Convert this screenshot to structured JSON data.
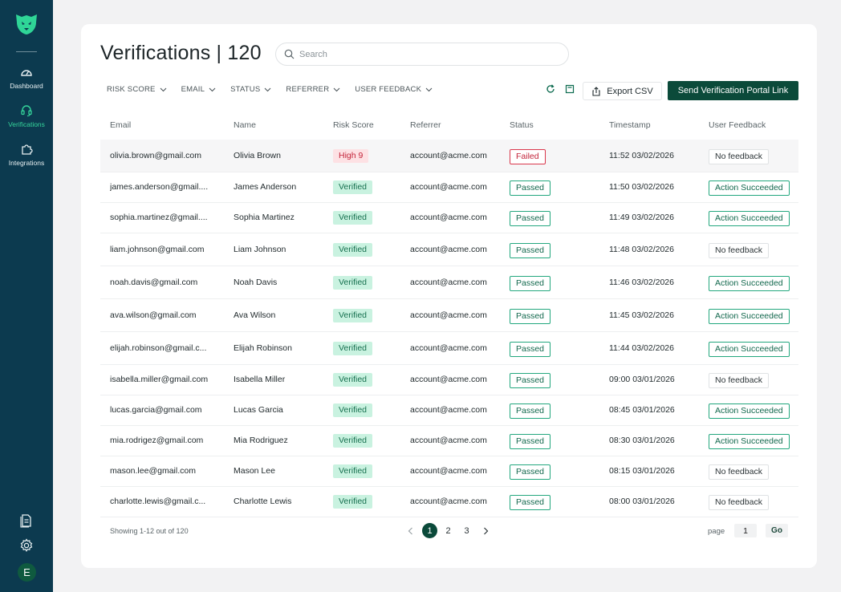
{
  "sidebar": {
    "items": [
      {
        "label": "Dashboard",
        "icon": "dashboard-icon"
      },
      {
        "label": "Verifications",
        "icon": "headset-icon",
        "active": true
      },
      {
        "label": "Integrations",
        "icon": "puzzle-icon"
      }
    ],
    "avatar_initial": "E"
  },
  "header": {
    "title": "Verifications | 120",
    "search_placeholder": "Search"
  },
  "filters": [
    "RISK SCORE",
    "EMAIL",
    "STATUS",
    "REFERRER",
    "USER FEEDBACK"
  ],
  "toolbar": {
    "export_label": "Export CSV",
    "send_label": "Send Verification Portal Link"
  },
  "table": {
    "columns": [
      "Email",
      "Name",
      "Risk Score",
      "Referrer",
      "Status",
      "Timestamp",
      "User Feedback"
    ],
    "rows": [
      {
        "email": "olivia.brown@gmail.com",
        "name": "Olivia Brown",
        "risk": "High 9",
        "referrer": "account@acme.com",
        "status": "Failed",
        "timestamp": "11:52 03/02/2026",
        "feedback": "No feedback"
      },
      {
        "email": "james.anderson@gmail....",
        "name": "James Anderson",
        "risk": "Verified",
        "referrer": "account@acme.com",
        "status": "Passed",
        "timestamp": "11:50 03/02/2026",
        "feedback": "Action Succeeded"
      },
      {
        "email": "sophia.martinez@gmail....",
        "name": "Sophia Martinez",
        "risk": "Verified",
        "referrer": "account@acme.com",
        "status": "Passed",
        "timestamp": "11:49 03/02/2026",
        "feedback": "Action Succeeded"
      },
      {
        "email": "liam.johnson@gmail.com",
        "name": "Liam Johnson",
        "risk": "Verified",
        "referrer": "account@acme.com",
        "status": "Passed",
        "timestamp": "11:48 03/02/2026",
        "feedback": "No feedback"
      },
      {
        "email": "noah.davis@gmail.com",
        "name": "Noah Davis",
        "risk": "Verified",
        "referrer": "account@acme.com",
        "status": "Passed",
        "timestamp": "11:46 03/02/2026",
        "feedback": "Action Succeeded"
      },
      {
        "email": "ava.wilson@gmail.com",
        "name": "Ava Wilson",
        "risk": "Verified",
        "referrer": "account@acme.com",
        "status": "Passed",
        "timestamp": "11:45 03/02/2026",
        "feedback": "Action Succeeded"
      },
      {
        "email": "elijah.robinson@gmail.c...",
        "name": "Elijah Robinson",
        "risk": "Verified",
        "referrer": "account@acme.com",
        "status": "Passed",
        "timestamp": "11:44 03/02/2026",
        "feedback": "Action Succeeded"
      },
      {
        "email": "isabella.miller@gmail.com",
        "name": "Isabella Miller",
        "risk": "Verified",
        "referrer": "account@acme.com",
        "status": "Passed",
        "timestamp": "09:00 03/01/2026",
        "feedback": "No feedback"
      },
      {
        "email": "lucas.garcia@gmail.com",
        "name": "Lucas Garcia",
        "risk": "Verified",
        "referrer": "account@acme.com",
        "status": "Passed",
        "timestamp": "08:45 03/01/2026",
        "feedback": "Action Succeeded"
      },
      {
        "email": "mia.rodrigez@gmail.com",
        "name": "Mia Rodriguez",
        "risk": "Verified",
        "referrer": "account@acme.com",
        "status": "Passed",
        "timestamp": "08:30 03/01/2026",
        "feedback": "Action Succeeded"
      },
      {
        "email": "mason.lee@gmail.com",
        "name": "Mason Lee",
        "risk": "Verified",
        "referrer": "account@acme.com",
        "status": "Passed",
        "timestamp": "08:15 03/01/2026",
        "feedback": "No feedback"
      },
      {
        "email": "charlotte.lewis@gmail.c...",
        "name": "Charlotte Lewis",
        "risk": "Verified",
        "referrer": "account@acme.com",
        "status": "Passed",
        "timestamp": "08:00 03/01/2026",
        "feedback": "No feedback"
      }
    ]
  },
  "footer": {
    "showing": "Showing 1-12 out of 120",
    "pages": [
      "1",
      "2",
      "3"
    ],
    "current_page": "1",
    "page_label": "page",
    "page_value": "1",
    "go_label": "Go"
  },
  "colors": {
    "sidebar": "#0c3a4f",
    "accent": "#0b4a3a",
    "active_nav": "#35d39a"
  }
}
